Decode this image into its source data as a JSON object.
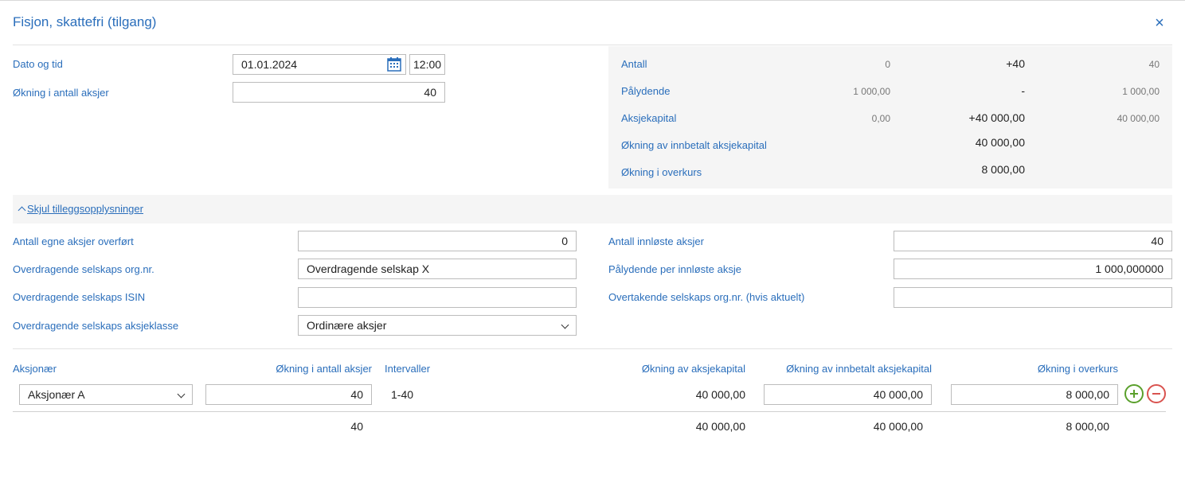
{
  "dialog": {
    "title": "Fisjon, skattefri (tilgang)",
    "close": "×"
  },
  "form": {
    "date_label": "Dato og tid",
    "date_value": "01.01.2024",
    "time_value": "12:00",
    "increase_label": "Økning i antall aksjer",
    "increase_value": "40"
  },
  "summary": {
    "rows": [
      {
        "label": "Antall",
        "before": "0",
        "change": "+40",
        "after": "40"
      },
      {
        "label": "Pålydende",
        "before": "1 000,00",
        "change": "-",
        "after": "1 000,00"
      },
      {
        "label": "Aksjekapital",
        "before": "0,00",
        "change": "+40 000,00",
        "after": "40 000,00"
      },
      {
        "label": "Økning av innbetalt aksjekapital",
        "before": "",
        "change": "40 000,00",
        "after": ""
      },
      {
        "label": "Økning i overkurs",
        "before": "",
        "change": "8 000,00",
        "after": ""
      }
    ]
  },
  "extra": {
    "toggle_label": "Skjul tilleggsopplysninger",
    "own_shares_label": "Antall egne aksjer overført",
    "own_shares_value": "0",
    "transferor_org_label": "Overdragende selskaps org.nr.",
    "transferor_org_value": "Overdragende selskap X",
    "transferor_isin_label": "Overdragende selskaps ISIN",
    "transferor_isin_value": "",
    "transferor_class_label": "Overdragende selskaps aksjeklasse",
    "transferor_class_value": "Ordinære aksjer",
    "redeemed_label": "Antall innløste aksjer",
    "redeemed_value": "40",
    "nominal_redeemed_label": "Pålydende per innløste aksje",
    "nominal_redeemed_value": "1 000,000000",
    "acquirer_org_label": "Overtakende selskaps org.nr. (hvis aktuelt)",
    "acquirer_org_value": ""
  },
  "shareholders": {
    "headers": {
      "holder": "Aksjonær",
      "increase": "Økning i antall aksjer",
      "intervals": "Intervaller",
      "capital": "Økning av aksjekapital",
      "paid_in": "Økning av innbetalt aksjekapital",
      "premium": "Økning i overkurs"
    },
    "row": {
      "holder": "Aksjonær A",
      "increase": "40",
      "intervals": "1-40",
      "capital": "40 000,00",
      "paid_in": "40 000,00",
      "premium": "8 000,00"
    },
    "totals": {
      "increase": "40",
      "capital": "40 000,00",
      "paid_in": "40 000,00",
      "premium": "8 000,00"
    }
  },
  "icons": {
    "calendar": "calendar-icon",
    "add": "plus-circle-icon",
    "remove": "minus-circle-icon"
  },
  "colors": {
    "accent": "#2a6ebb",
    "add": "#5aa02c",
    "remove": "#d9534f"
  }
}
